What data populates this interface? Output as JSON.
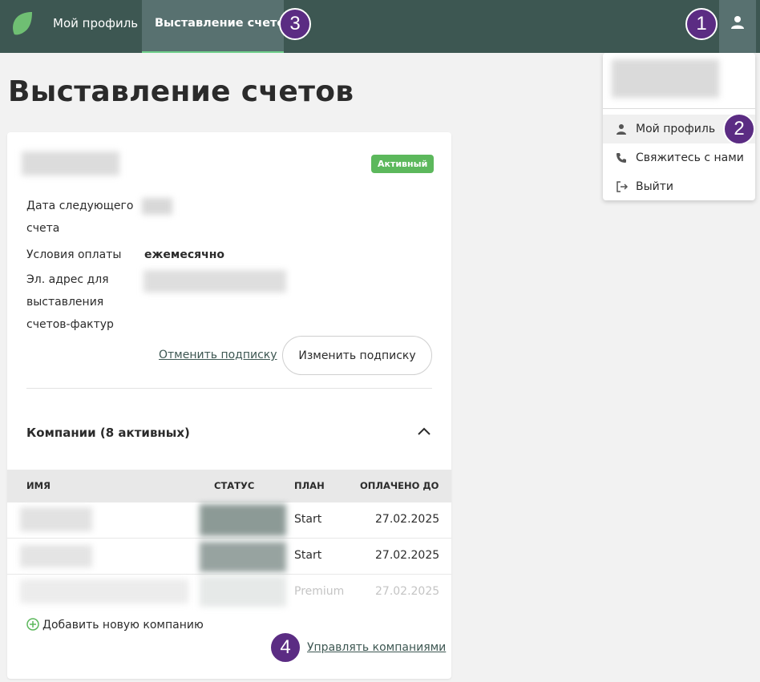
{
  "nav": {
    "profile_tab": "Мой профиль",
    "billing_tab": "Выставление счетов"
  },
  "markers": [
    "1",
    "2",
    "3",
    "4"
  ],
  "page": {
    "title": "Выставление счетов"
  },
  "subscription": {
    "status": "Активный",
    "next_bill_label": "Дата следующего счета",
    "payment_terms_label": "Условия оплаты",
    "payment_terms_value": "ежемесячно",
    "invoice_email_label": "Эл. адрес для выставления счетов-фактур",
    "cancel_label": "Отменить подписку",
    "change_label": "Изменить подписку"
  },
  "companies": {
    "title": "Компании (8 активных)",
    "columns": [
      "ИМЯ",
      "СТАТУС",
      "ПЛАН",
      "ОПЛАЧЕНО ДО"
    ],
    "rows": [
      {
        "plan": "Start",
        "paid_until": "27.02.2025"
      },
      {
        "plan": "Start",
        "paid_until": "27.02.2025"
      },
      {
        "plan": "Premium",
        "paid_until": "27.02.2025"
      }
    ],
    "add_label": "Добавить новую компанию",
    "manage_label": "Управлять компаниями"
  },
  "dropdown": {
    "items": [
      {
        "label": "Мой профиль",
        "icon": "user-icon"
      },
      {
        "label": "Свяжитесь с нами",
        "icon": "phone-icon"
      },
      {
        "label": "Выйти",
        "icon": "logout-icon"
      }
    ]
  },
  "colors": {
    "topbar": "#3d5752",
    "active_tab": "#587170",
    "marker": "#5b2c83",
    "status_green": "#5cb85c"
  }
}
